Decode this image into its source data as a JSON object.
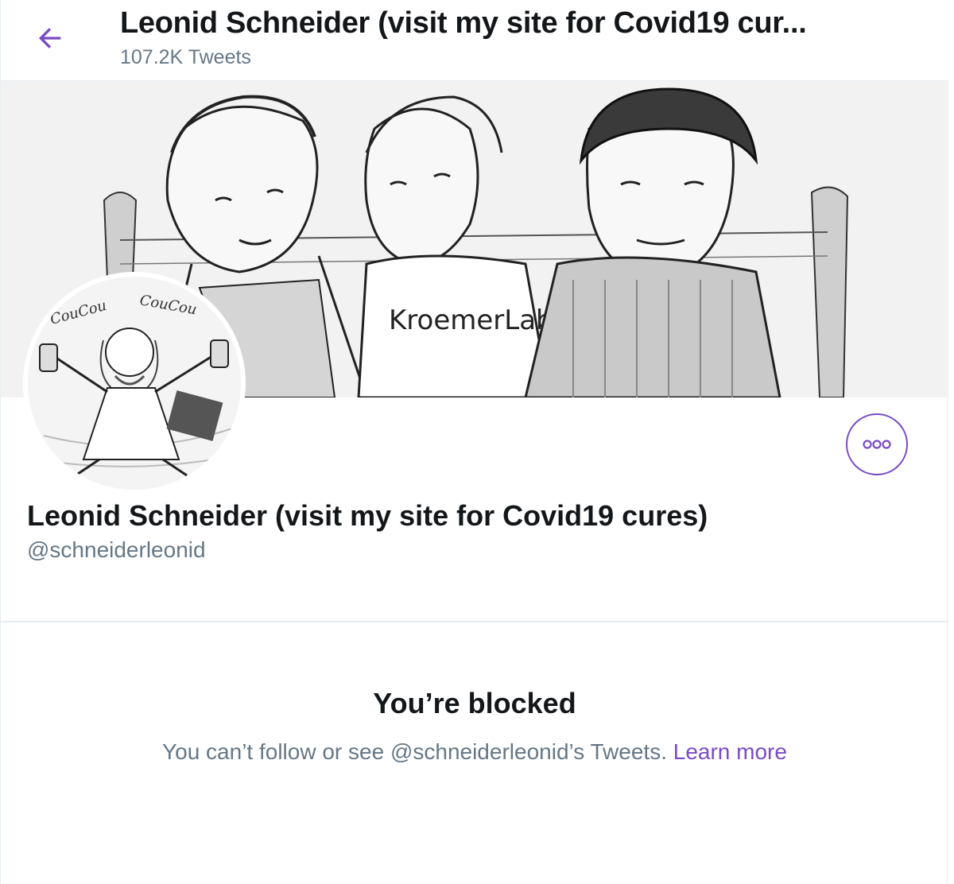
{
  "header": {
    "title": "Leonid Schneider (visit my site for Covid19 cur...",
    "tweet_count": "107.2K Tweets"
  },
  "banner": {
    "shirt_text": "KroemerLab"
  },
  "avatar": {
    "caption_left": "CouCou",
    "caption_right": "CouCou"
  },
  "profile": {
    "display_name": "Leonid Schneider (visit my site for Covid19 cures)",
    "handle": "@schneiderleonid"
  },
  "blocked": {
    "title": "You’re blocked",
    "message": "You can’t follow or see @schneiderleonid’s Tweets.",
    "link_text": "Learn more"
  },
  "colors": {
    "accent": "#794bc4",
    "text_primary": "#14171a",
    "text_secondary": "#657786",
    "border": "#e6ecf0"
  },
  "icons": {
    "back": "arrow-left-icon",
    "more": "more-horizontal-icon"
  }
}
